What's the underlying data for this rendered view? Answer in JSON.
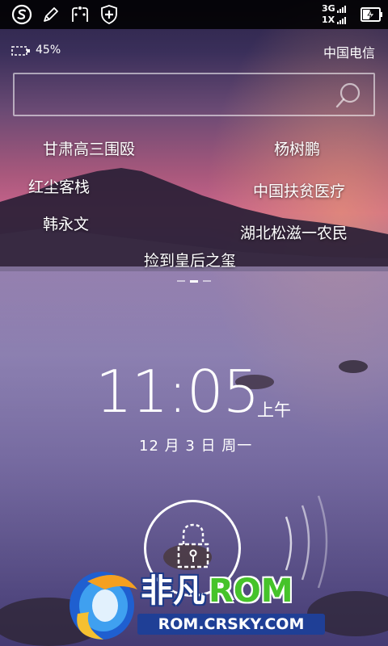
{
  "status_bar": {
    "network_top": "3G",
    "network_bottom": "1X",
    "icons": [
      "sogou-icon",
      "edit-icon",
      "screenshot-icon",
      "shield-icon",
      "signal-icon",
      "battery-charging-icon"
    ]
  },
  "info": {
    "battery_percent": "45%",
    "battery_level": 0.45,
    "carrier": "中国电信"
  },
  "search": {
    "placeholder": ""
  },
  "hot_keywords": [
    "甘肃高三围殴",
    "杨树鹏",
    "红尘客栈",
    "中国扶贫医疗",
    "韩永文",
    "湖北松滋一农民",
    "捡到皇后之玺"
  ],
  "pager": {
    "pages": 3,
    "current": 2
  },
  "clock": {
    "time": "11:05",
    "ampm": "上午",
    "date": "12 月 3 日 周一"
  },
  "watermark": {
    "brand_cn": "非凡",
    "brand_en": "ROM",
    "url": "ROM.CRSKY.COM"
  },
  "colors": {
    "accent_green": "#46c32a",
    "watermark_blue": "#1f3f96",
    "sky_top": "#2c2448",
    "sky_glow": "#c9648c",
    "water": "#8a7fb0"
  }
}
